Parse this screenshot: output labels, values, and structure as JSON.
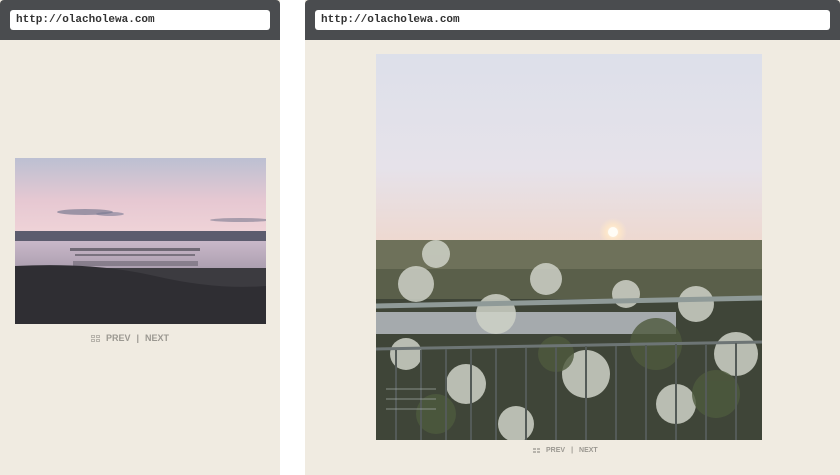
{
  "left_window": {
    "url": "http://olacholewa.com",
    "nav": {
      "prev": "PREV",
      "separator": "|",
      "next": "NEXT"
    }
  },
  "right_window": {
    "url": "http://olacholewa.com",
    "nav": {
      "prev": "PREV",
      "separator": "|",
      "next": "NEXT"
    }
  }
}
